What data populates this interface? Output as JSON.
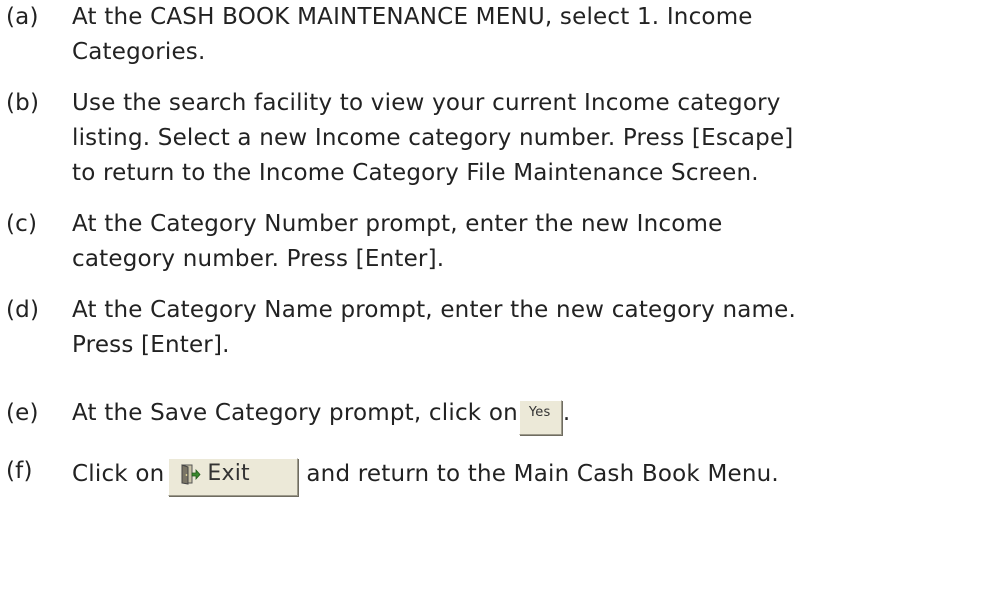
{
  "steps": [
    {
      "marker": "(a)",
      "lines": [
        "At the CASH BOOK MAINTENANCE MENU, select 1. Income",
        "Categories."
      ]
    },
    {
      "marker": "(b)",
      "lines": [
        "Use the search facility to view your current Income category",
        "listing. Select a new Income category number. Press [Escape]",
        "to return to the Income Category File Maintenance Screen."
      ]
    },
    {
      "marker": "(c)",
      "lines": [
        "At the Category Number prompt, enter the new Income",
        "category number. Press [Enter]."
      ]
    },
    {
      "marker": "(d)",
      "lines": [
        "At the Category Name prompt, enter the new category name.",
        "Press [Enter]."
      ]
    },
    {
      "marker": "(e)",
      "before": "At the Save Category prompt, click on",
      "after": "."
    },
    {
      "marker": "(f)",
      "before": "Click on",
      "after": "and return to the Main Cash Book Menu."
    }
  ],
  "buttons": {
    "yes_label": "Yes",
    "exit_label": "Exit",
    "exit_icon": "exit-door-icon"
  },
  "colors": {
    "button_face": "#ece9d8",
    "icon_green": "#3a8a2e",
    "text": "#222222"
  }
}
